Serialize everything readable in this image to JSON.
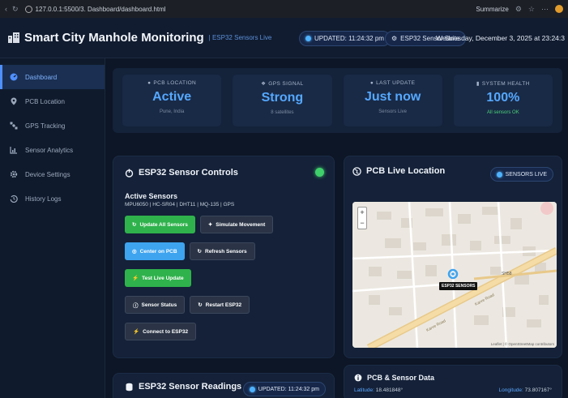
{
  "browser": {
    "url": "127.0.0.1:5500/3. Dashboard/dashboard.html",
    "profile": "Summarize"
  },
  "header": {
    "title": "Smart City Manhole Monitoring",
    "subtitle": "| ESP32 Sensors Live",
    "updated": "UPDATED: 11:24:32 pm",
    "suite": "ESP32 Sensor Suite",
    "date": "Wednesday, December 3, 2025 at 23:24:3"
  },
  "sidebar": {
    "items": [
      {
        "label": "Dashboard",
        "icon": "dashboard-icon"
      },
      {
        "label": "PCB Location",
        "icon": "map-pin-icon"
      },
      {
        "label": "GPS Tracking",
        "icon": "satellite-icon"
      },
      {
        "label": "Sensor Analytics",
        "icon": "chart-icon"
      },
      {
        "label": "Device Settings",
        "icon": "gear-icon"
      },
      {
        "label": "History Logs",
        "icon": "history-icon"
      }
    ]
  },
  "stats": [
    {
      "label": "PCB LOCATION",
      "value": "Active",
      "sub": "Pune, India"
    },
    {
      "label": "GPS SIGNAL",
      "value": "Strong",
      "sub": "8 satellites"
    },
    {
      "label": "LAST UPDATE",
      "value": "Just now",
      "sub": "Sensors Live"
    },
    {
      "label": "SYSTEM HEALTH",
      "value": "100%",
      "sub": "All sensors OK"
    }
  ],
  "controls": {
    "title": "ESP32 Sensor Controls",
    "active_title": "Active Sensors",
    "active_list": "MPU6050 | HC-SR04 | DHT11 | MQ-135 | GPS",
    "buttons": {
      "update_all": "Update All Sensors",
      "simulate": "Simulate Movement",
      "center": "Center on PCB",
      "refresh": "Refresh Sensors",
      "test_live": "Test Live Update",
      "status": "Sensor Status",
      "restart": "Restart ESP32",
      "connect": "Connect to ESP32"
    }
  },
  "location": {
    "title": "PCB Live Location",
    "pill": "SENSORS LIVE",
    "marker": "ESP32 SENSORS",
    "road1": "Karve Road",
    "road2": "Karve Road",
    "road_code": "SH58",
    "attribution": "Leaflet | © OpenStreetMap contributors"
  },
  "readings": {
    "title": "ESP32 Sensor Readings",
    "updated": "UPDATED: 11:24:32 pm"
  },
  "pcbdata": {
    "title": "PCB & Sensor Data",
    "lat_label": "Latitude:",
    "lat_value": "18.481848°",
    "lon_label": "Longitude:",
    "lon_value": "73.807167°"
  },
  "colors": {
    "accent": "#55a8ff",
    "green": "#2fb24c",
    "live": "#4fb2ff"
  }
}
